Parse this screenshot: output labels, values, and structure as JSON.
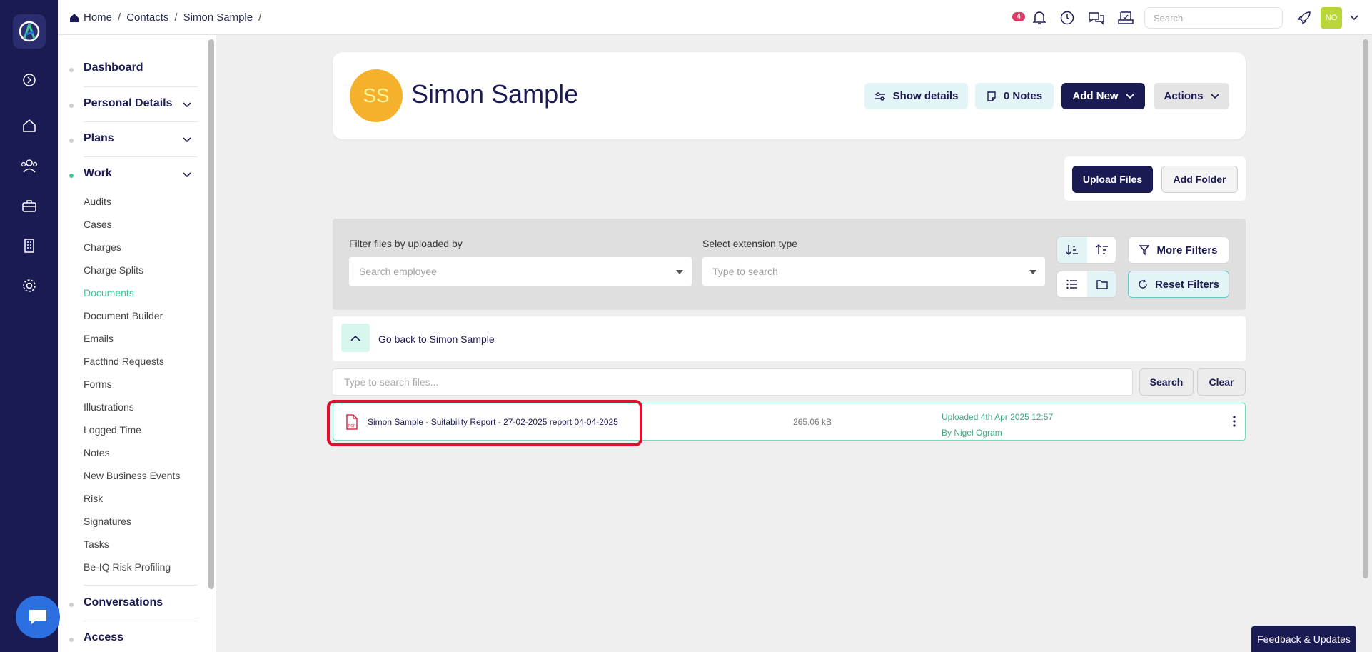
{
  "breadcrumb": {
    "home": "Home",
    "contacts": "Contacts",
    "contact": "Simon Sample",
    "separator": "/"
  },
  "topbar": {
    "notification_count": "4",
    "search_placeholder": "Search",
    "user_initials": "NO"
  },
  "sidebar": {
    "dashboard": "Dashboard",
    "personal_details": "Personal Details",
    "plans": "Plans",
    "work": "Work",
    "work_items": [
      "Audits",
      "Cases",
      "Charges",
      "Charge Splits",
      "Documents",
      "Document Builder",
      "Emails",
      "Factfind Requests",
      "Forms",
      "Illustrations",
      "Logged Time",
      "Notes",
      "New Business Events",
      "Risk",
      "Signatures",
      "Tasks",
      "Be-IQ Risk Profiling"
    ],
    "active_item": "Documents",
    "conversations": "Conversations",
    "access": "Access"
  },
  "profile": {
    "initials": "SS",
    "name": "Simon Sample",
    "show_details": "Show details",
    "notes": "0 Notes",
    "add_new": "Add New",
    "actions": "Actions"
  },
  "file_actions": {
    "upload": "Upload Files",
    "add_folder": "Add Folder"
  },
  "filters": {
    "uploaded_by_label": "Filter files by uploaded by",
    "uploaded_by_placeholder": "Search employee",
    "extension_label": "Select extension type",
    "extension_placeholder": "Type to search",
    "more_filters": "More Filters",
    "reset_filters": "Reset Filters"
  },
  "navigation": {
    "go_back": "Go back to Simon Sample"
  },
  "file_search": {
    "placeholder": "Type to search files...",
    "search": "Search",
    "clear": "Clear"
  },
  "files": [
    {
      "name": "Simon Sample - Suitability Report - 27-02-2025 report 04-04-2025",
      "size": "265.06 kB",
      "uploaded": "Uploaded 4th Apr 2025 12:57",
      "by": "By Nigel Ogram"
    }
  ],
  "feedback": "Feedback & Updates",
  "colors": {
    "navy": "#1b1b54",
    "accent_green": "#3fc79a",
    "avatar": "#f5b12b",
    "highlight": "#e0102e"
  },
  "icons": {
    "home": "home-icon",
    "bell": "bell-icon",
    "clock": "clock-icon",
    "chat": "chat-icon",
    "rocket": "rocket-icon",
    "pdf": "pdf-file-icon"
  }
}
